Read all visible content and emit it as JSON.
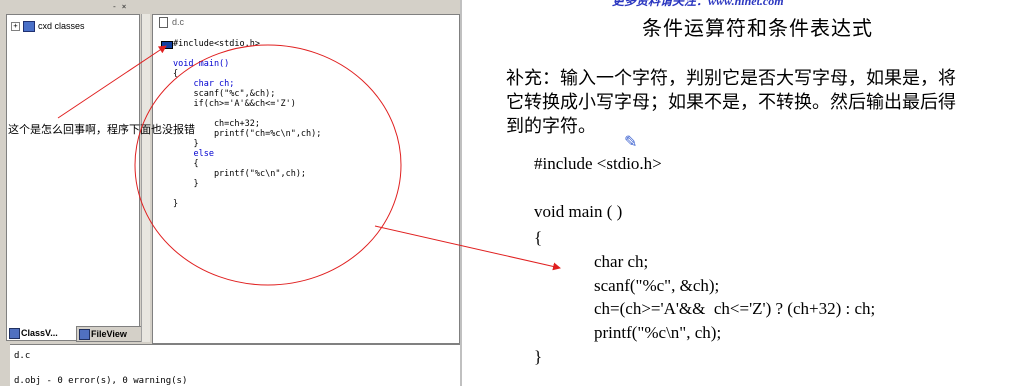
{
  "ide": {
    "class_tree_root": "cxd classes",
    "tree_expand_glyph": "+",
    "tree_header_buttons": "- ×",
    "tabs": [
      {
        "label": "ClassV..."
      },
      {
        "label": "FileView"
      }
    ],
    "editor_tab": "d.c",
    "code_lines": [
      "#include<stdio.h>",
      "",
      "void main()",
      "{",
      "    char ch;",
      "    scanf(\"%c\",&ch);",
      "    if(ch>='A'&&ch<='Z')",
      "",
      "        ch=ch+32;",
      "        printf(\"ch=%c\\n\",ch);",
      "    }",
      "    else",
      "    {",
      "        printf(\"%c\\n\",ch);",
      "    }",
      "",
      "}"
    ],
    "output_lines": [
      "d.c",
      "d.obj - 0 error(s), 0 warning(s)"
    ]
  },
  "annotation": {
    "text": "这个是怎么回事啊，程序下面也没报错",
    "color": "#e02020"
  },
  "slide": {
    "top_partial": "更多资料请关注：www.ninet.com",
    "title": "条件运算符和条件表达式",
    "paragraph_lines": [
      "补充：输入一个字符，判别它是否大写字母，如果是，将",
      "它转换成小写字母；如果不是，不转换。然后输出最后得",
      "到的字符。"
    ],
    "code_lines": [
      "#include <stdio.h>",
      "",
      "void main ( )",
      "{",
      "char ch;",
      "scanf(\"%c\", &ch);",
      "ch=(ch>='A'&&  ch<='Z') ? (ch+32) : ch;",
      "printf(\"%c\\n\", ch);",
      "}"
    ]
  },
  "colors": {
    "ide_face": "#d4d0c8",
    "keyword_blue": "#0000d0",
    "arrow_red": "#e02020"
  }
}
